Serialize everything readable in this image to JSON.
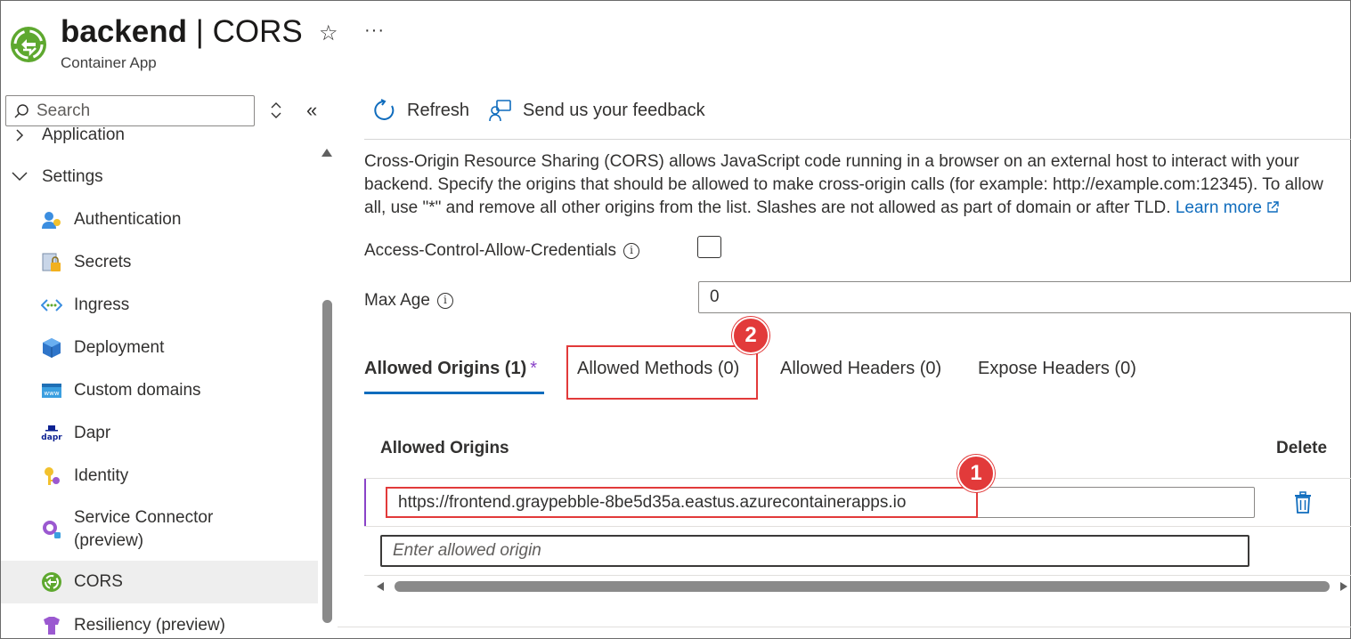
{
  "header": {
    "resource_name": "backend",
    "separator": "|",
    "page_name": "CORS",
    "subtitle": "Container App",
    "star_icon": "star-icon",
    "more_label": "···"
  },
  "sidebar": {
    "search_placeholder": "Search",
    "items": [
      {
        "label": "Application",
        "icon": "chevron-right-icon",
        "type": "group"
      },
      {
        "label": "Settings",
        "icon": "chevron-down-icon",
        "type": "group"
      },
      {
        "label": "Authentication",
        "icon": "authentication-icon"
      },
      {
        "label": "Secrets",
        "icon": "secrets-icon"
      },
      {
        "label": "Ingress",
        "icon": "ingress-icon"
      },
      {
        "label": "Deployment",
        "icon": "deployment-icon"
      },
      {
        "label": "Custom domains",
        "icon": "custom-domains-icon"
      },
      {
        "label": "Dapr",
        "icon": "dapr-icon"
      },
      {
        "label": "Identity",
        "icon": "identity-icon"
      },
      {
        "label": "Service Connector",
        "label2": "(preview)",
        "icon": "service-connector-icon"
      },
      {
        "label": "CORS",
        "icon": "cors-icon",
        "selected": true
      },
      {
        "label": "Resiliency (preview)",
        "icon": "resiliency-icon"
      }
    ]
  },
  "toolbar": {
    "refresh_label": "Refresh",
    "feedback_label": "Send us your feedback"
  },
  "main": {
    "description": "Cross-Origin Resource Sharing (CORS) allows JavaScript code running in a browser on an external host to interact with your backend. Specify the origins that should be allowed to make cross-origin calls (for example: http://example.com:12345). To allow all, use \"*\" and remove all other origins from the list. Slashes are not allowed as part of domain or after TLD.",
    "learn_more": "Learn more",
    "credentials_label": "Access-Control-Allow-Credentials",
    "credentials_checked": false,
    "max_age_label": "Max Age",
    "max_age_value": "0",
    "tabs": [
      {
        "label": "Allowed Origins (1)",
        "active": true,
        "marker": "*"
      },
      {
        "label": "Allowed Methods (0)"
      },
      {
        "label": "Allowed Headers (0)"
      },
      {
        "label": "Expose Headers (0)"
      }
    ],
    "table": {
      "col_origins": "Allowed Origins",
      "col_delete": "Delete",
      "rows": [
        "https://frontend.graypebble-8be5d35a.eastus.azurecontainerapps.io"
      ],
      "new_placeholder": "Enter allowed origin"
    },
    "annotations": {
      "badge1": "1",
      "badge2": "2"
    }
  },
  "colors": {
    "accent": "#0f6cbd",
    "highlight": "#e23a3a",
    "required_marker": "#8a43c8",
    "selected_bg": "#eeeeee"
  }
}
